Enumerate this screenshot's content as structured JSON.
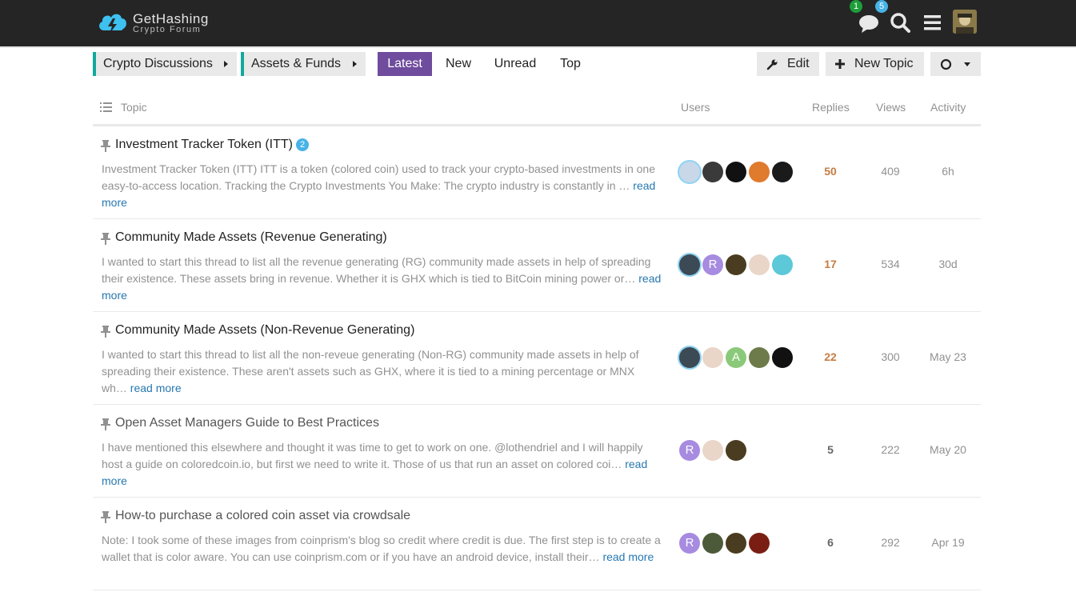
{
  "header": {
    "logo_title": "GetHashing",
    "logo_subtitle": "Crypto Forum",
    "messages_badge": "1",
    "notifications_badge": "5",
    "icons": [
      "chat-icon",
      "search-icon",
      "menu-icon",
      "user-avatar"
    ]
  },
  "nav": {
    "breadcrumbs": [
      {
        "label": "Crypto Discussions"
      },
      {
        "label": "Assets & Funds"
      }
    ],
    "tabs": [
      {
        "label": "Latest",
        "active": true
      },
      {
        "label": "New"
      },
      {
        "label": "Unread"
      },
      {
        "label": "Top"
      }
    ],
    "edit_label": "Edit",
    "new_topic_label": "New Topic"
  },
  "table": {
    "columns": {
      "topic": "Topic",
      "users": "Users",
      "replies": "Replies",
      "views": "Views",
      "activity": "Activity"
    },
    "read_more": "read more",
    "rows": [
      {
        "title": "Investment Tracker Token (ITT)",
        "unread_badge": "2",
        "excerpt": "Investment Tracker Token (ITT) ITT is a token (colored coin) used to track your crypto-based investments in one easy-to-access location. Tracking the Crypto Investments You Make: The crypto industry is constantly in …",
        "replies": "50",
        "views": "409",
        "activity": "6h",
        "avatars": [
          {
            "color": "#c8d8e8",
            "letter": ""
          },
          {
            "color": "#3a3a3a",
            "letter": ""
          },
          {
            "color": "#111111",
            "letter": ""
          },
          {
            "color": "#e07a2c",
            "letter": ""
          },
          {
            "color": "#1a1a1a",
            "letter": ""
          }
        ]
      },
      {
        "title": "Community Made Assets (Revenue Generating)",
        "excerpt": "I wanted to start this thread to list all the revenue generating (RG) community made assets in help of spreading their existence. These assets bring in revenue. Whether it is GHX which is tied to BitCoin mining power or…",
        "replies": "17",
        "views": "534",
        "activity": "30d",
        "avatars": [
          {
            "color": "#3b4a55",
            "letter": ""
          },
          {
            "color": "#a78be0",
            "letter": "R"
          },
          {
            "color": "#4a3c20",
            "letter": ""
          },
          {
            "color": "#e9d6c8",
            "letter": ""
          },
          {
            "color": "#5cc8d8",
            "letter": ""
          }
        ]
      },
      {
        "title": "Community Made Assets (Non-Revenue Generating)",
        "excerpt": "I wanted to start this thread to list all the non-reveue generating (Non-RG) community made assets in help of spreading their existence. These aren't assets such as GHX, where it is tied to a mining percentage or MNX wh…",
        "replies": "22",
        "views": "300",
        "activity": "May 23",
        "avatars": [
          {
            "color": "#3b4a55",
            "letter": ""
          },
          {
            "color": "#e9d6c8",
            "letter": ""
          },
          {
            "color": "#8bc97a",
            "letter": "A"
          },
          {
            "color": "#6d7a4a",
            "letter": ""
          },
          {
            "color": "#111111",
            "letter": ""
          }
        ]
      },
      {
        "title": "Open Asset Managers Guide to Best Practices",
        "excerpt": "I have mentioned this elsewhere and thought it was time to get to work on one. @lothendriel and I will happily host a guide on coloredcoin.io, but first we need to write it. Those of us that run an asset on colored coi…",
        "replies": "5",
        "views": "222",
        "activity": "May 20",
        "avatars": [
          {
            "color": "#a78be0",
            "letter": "R"
          },
          {
            "color": "#e9d6c8",
            "letter": ""
          },
          {
            "color": "#4a3c20",
            "letter": ""
          }
        ]
      },
      {
        "title": "How-to purchase a colored coin asset via crowdsale",
        "excerpt": "Note: I took some of these images from coinprism's blog so credit where credit is due. The first step is to create a wallet that is color aware. You can use coinprism.com or if you have an android device, install their…",
        "replies": "6",
        "views": "292",
        "activity": "Apr 19",
        "avatars": [
          {
            "color": "#a78be0",
            "letter": "R"
          },
          {
            "color": "#4d5a3a",
            "letter": ""
          },
          {
            "color": "#4a3c20",
            "letter": ""
          },
          {
            "color": "#7a1e14",
            "letter": ""
          }
        ]
      }
    ]
  },
  "colors": {
    "accent_purple": "#6f4c9e",
    "category_teal": "#12a89d",
    "reply_hot": "#c57d45",
    "reply_normal": "#666666",
    "link": "#2678b0"
  }
}
